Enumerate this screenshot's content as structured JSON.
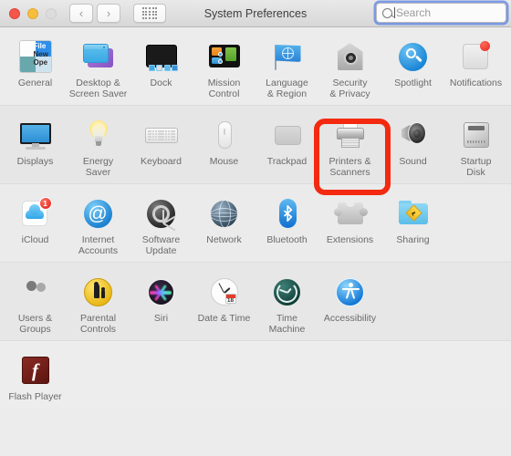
{
  "window": {
    "title": "System Preferences",
    "controls": {
      "close": "close-button",
      "minimize": "minimize-button",
      "zoom": "zoom-button"
    },
    "toolbar": {
      "back_label": "‹",
      "forward_label": "›",
      "show_all_label": "show-all-grid"
    },
    "search": {
      "placeholder": "Search",
      "value": ""
    }
  },
  "annotation": {
    "target": "Printers & Scanners",
    "color": "#f32a10"
  },
  "rows": [
    {
      "id": "row-1",
      "items": [
        {
          "label": "General",
          "icon": "general-icon"
        },
        {
          "label": "Desktop &\nScreen Saver",
          "icon": "desktop-screensaver-icon"
        },
        {
          "label": "Dock",
          "icon": "dock-icon"
        },
        {
          "label": "Mission\nControl",
          "icon": "mission-control-icon"
        },
        {
          "label": "Language\n& Region",
          "icon": "language-region-icon"
        },
        {
          "label": "Security\n& Privacy",
          "icon": "security-privacy-icon"
        },
        {
          "label": "Spotlight",
          "icon": "spotlight-icon"
        },
        {
          "label": "Notifications",
          "icon": "notifications-icon",
          "badge": "dot"
        }
      ]
    },
    {
      "id": "row-2",
      "items": [
        {
          "label": "Displays",
          "icon": "displays-icon"
        },
        {
          "label": "Energy\nSaver",
          "icon": "energy-saver-icon"
        },
        {
          "label": "Keyboard",
          "icon": "keyboard-icon"
        },
        {
          "label": "Mouse",
          "icon": "mouse-icon"
        },
        {
          "label": "Trackpad",
          "icon": "trackpad-icon"
        },
        {
          "label": "Printers &\nScanners",
          "icon": "printers-scanners-icon",
          "highlighted": true
        },
        {
          "label": "Sound",
          "icon": "sound-icon"
        },
        {
          "label": "Startup\nDisk",
          "icon": "startup-disk-icon"
        }
      ]
    },
    {
      "id": "row-3",
      "items": [
        {
          "label": "iCloud",
          "icon": "icloud-icon",
          "badge": "1"
        },
        {
          "label": "Internet\nAccounts",
          "icon": "internet-accounts-icon"
        },
        {
          "label": "Software\nUpdate",
          "icon": "software-update-icon"
        },
        {
          "label": "Network",
          "icon": "network-icon"
        },
        {
          "label": "Bluetooth",
          "icon": "bluetooth-icon"
        },
        {
          "label": "Extensions",
          "icon": "extensions-icon"
        },
        {
          "label": "Sharing",
          "icon": "sharing-icon"
        }
      ]
    },
    {
      "id": "row-4",
      "items": [
        {
          "label": "Users &\nGroups",
          "icon": "users-groups-icon"
        },
        {
          "label": "Parental\nControls",
          "icon": "parental-controls-icon"
        },
        {
          "label": "Siri",
          "icon": "siri-icon"
        },
        {
          "label": "Date & Time",
          "icon": "date-time-icon"
        },
        {
          "label": "Time\nMachine",
          "icon": "time-machine-icon"
        },
        {
          "label": "Accessibility",
          "icon": "accessibility-icon"
        }
      ]
    },
    {
      "id": "row-5",
      "items": [
        {
          "label": "Flash Player",
          "icon": "flash-player-icon"
        }
      ]
    }
  ]
}
